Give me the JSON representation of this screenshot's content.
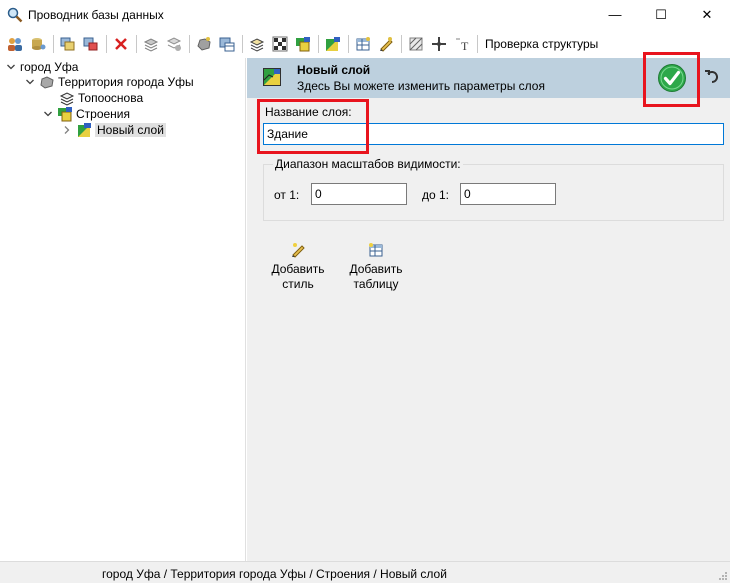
{
  "window": {
    "title": "Проводник базы данных",
    "minimize_glyph": "—",
    "maximize_glyph": "☐",
    "close_glyph": "✕"
  },
  "toolbar": {
    "check_structure_label": "Проверка структуры"
  },
  "tree": {
    "root": "город Уфа",
    "territory": "Территория города Уфы",
    "topo": "Топооснова",
    "buildings": "Строения",
    "new_layer": "Новый слой"
  },
  "panel": {
    "header_title": "Новый слой",
    "header_subtitle": "Здесь Вы можете изменить параметры слоя",
    "name_label": "Название слоя:",
    "name_value": "Здание",
    "scale_group_label": "Диапазон масштабов видимости:",
    "from_label": "от 1:",
    "from_value": "0",
    "to_label": "до 1:",
    "to_value": "0",
    "add_style_line1": "Добавить",
    "add_style_line2": "стиль",
    "add_table_line1": "Добавить",
    "add_table_line2": "таблицу"
  },
  "statusbar": {
    "path": "город Уфа / Территория города Уфы / Строения / Новый слой"
  },
  "colors": {
    "highlight": "#e8141e",
    "header_bg": "#bdd0de",
    "apply_green": "#2da84a",
    "focus_border": "#0078d7"
  }
}
